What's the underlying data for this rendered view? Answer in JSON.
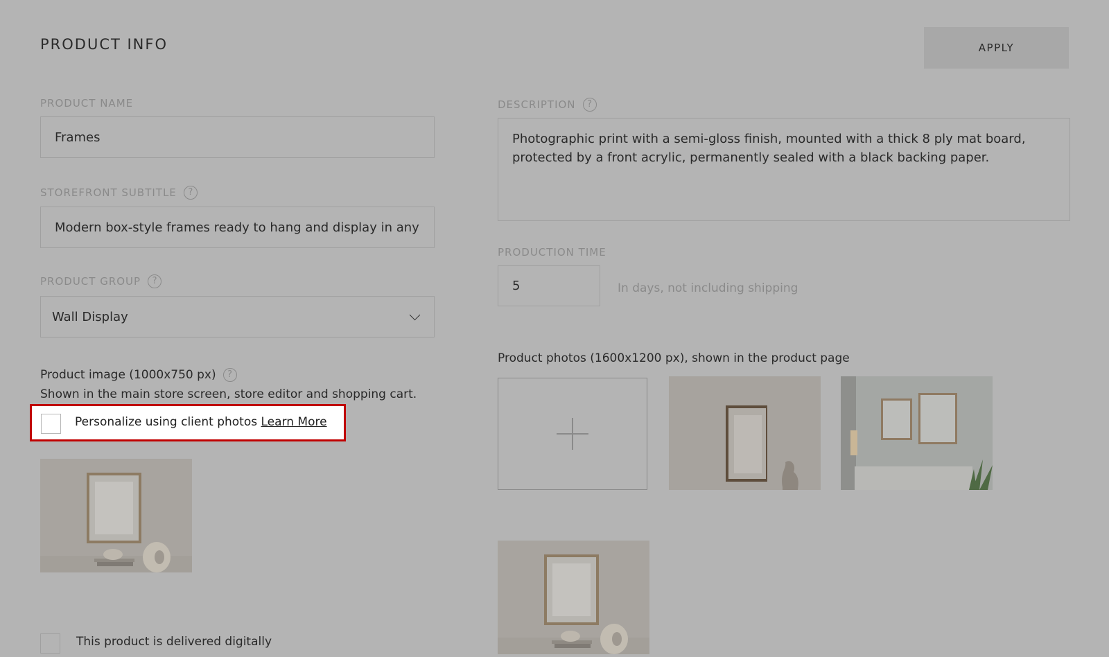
{
  "header": {
    "title": "PRODUCT INFO",
    "apply_label": "APPLY"
  },
  "product_name": {
    "label": "PRODUCT NAME",
    "value": "Frames"
  },
  "storefront_subtitle": {
    "label": "STOREFRONT SUBTITLE",
    "value": "Modern box-style frames ready to hang and display in any"
  },
  "product_group": {
    "label": "PRODUCT GROUP",
    "value": "Wall Display"
  },
  "product_image": {
    "title": "Product image (1000x750 px)",
    "subtitle": "Shown in the main store screen, store editor and shopping cart."
  },
  "personalize": {
    "label": "Personalize using client photos",
    "link": "Learn More",
    "checked": false
  },
  "digital": {
    "label": "This product is delivered digitally",
    "checked": false
  },
  "description": {
    "label": "DESCRIPTION",
    "value": "Photographic print with a semi-gloss finish, mounted with a thick 8 ply mat board, protected by a front acrylic, permanently sealed with a black backing paper."
  },
  "production_time": {
    "label": "PRODUCTION TIME",
    "value": "5",
    "hint": "In days, not including shipping"
  },
  "product_photos": {
    "title": "Product photos (1600x1200 px), shown in the product page"
  },
  "icons": {
    "help": "question-mark-icon",
    "chevron": "chevron-down-icon",
    "add": "plus-icon"
  },
  "colors": {
    "overlay": "#b4b4b4",
    "highlight_border": "#c00000"
  }
}
